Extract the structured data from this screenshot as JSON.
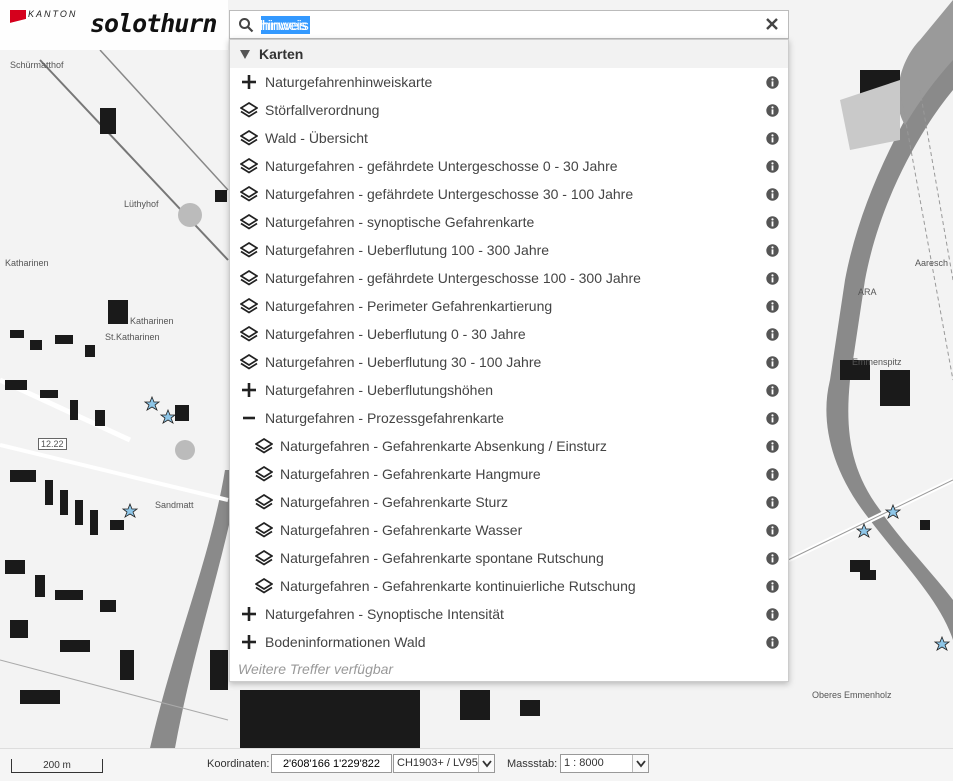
{
  "logo": {
    "kanton": "KANTON",
    "name": "solothurn",
    "flag_color": "#d5001c"
  },
  "search": {
    "query": "hinweis",
    "placeholder": ""
  },
  "results": {
    "section_title": "Karten",
    "items": [
      {
        "label": "Naturgefahrenhinweiskarte",
        "icon": "plus-icon",
        "level": 0
      },
      {
        "label": "Störfallverordnung",
        "icon": "layers-icon",
        "level": 0
      },
      {
        "label": "Wald - Übersicht",
        "icon": "layers-icon",
        "level": 0
      },
      {
        "label": "Naturgefahren - gefährdete Untergeschosse 0 - 30 Jahre",
        "icon": "layers-icon",
        "level": 0
      },
      {
        "label": "Naturgefahren - gefährdete Untergeschosse 30 - 100 Jahre",
        "icon": "layers-icon",
        "level": 0
      },
      {
        "label": "Naturgefahren - synoptische Gefahrenkarte",
        "icon": "layers-icon",
        "level": 0
      },
      {
        "label": "Naturgefahren - Ueberflutung 100 - 300 Jahre",
        "icon": "layers-icon",
        "level": 0
      },
      {
        "label": "Naturgefahren - gefährdete Untergeschosse 100 - 300 Jahre",
        "icon": "layers-icon",
        "level": 0
      },
      {
        "label": "Naturgefahren - Perimeter Gefahrenkartierung",
        "icon": "layers-icon",
        "level": 0
      },
      {
        "label": "Naturgefahren - Ueberflutung 0 - 30 Jahre",
        "icon": "layers-icon",
        "level": 0
      },
      {
        "label": "Naturgefahren - Ueberflutung 30 - 100 Jahre",
        "icon": "layers-icon",
        "level": 0
      },
      {
        "label": "Naturgefahren - Ueberflutungshöhen",
        "icon": "plus-icon",
        "level": 0
      },
      {
        "label": "Naturgefahren - Prozessgefahrenkarte",
        "icon": "minus-icon",
        "level": 0
      },
      {
        "label": "Naturgefahren - Gefahrenkarte Absenkung / Einsturz",
        "icon": "layers-icon",
        "level": 1
      },
      {
        "label": "Naturgefahren - Gefahrenkarte Hangmure",
        "icon": "layers-icon",
        "level": 1
      },
      {
        "label": "Naturgefahren - Gefahrenkarte Sturz",
        "icon": "layers-icon",
        "level": 1
      },
      {
        "label": "Naturgefahren - Gefahrenkarte Wasser",
        "icon": "layers-icon",
        "level": 1
      },
      {
        "label": "Naturgefahren - Gefahrenkarte spontane Rutschung",
        "icon": "layers-icon",
        "level": 1
      },
      {
        "label": "Naturgefahren - Gefahrenkarte kontinuierliche Rutschung",
        "icon": "layers-icon",
        "level": 1
      },
      {
        "label": "Naturgefahren - Synoptische Intensität",
        "icon": "plus-icon",
        "level": 0
      },
      {
        "label": "Bodeninformationen Wald",
        "icon": "plus-icon",
        "level": 0
      }
    ],
    "more_text": "Weitere Treffer verfügbar"
  },
  "map_labels": {
    "schuermatthof": "Schürmatthof",
    "luethyhof": "Lüthyhof",
    "katharinen": "Katharinen",
    "katharinen2": "Katharinen",
    "st_katharinen": "St.Katharinen",
    "sandmatt": "Sandmatt",
    "road": "12.22",
    "aareschachen": "Aaresch",
    "ara": "ARA",
    "emmenspitz": "Emmenspitz",
    "oberes_emmenholz": "Oberes Emmenholz"
  },
  "bottombar": {
    "scale_text": "200 m",
    "coord_label": "Koordinaten:",
    "coord_value": "2'608'166 1'229'822",
    "crs_value": "CH1903+ / LV95",
    "scale_label": "Massstab:",
    "scale_value": "1 : 8000"
  },
  "colors": {
    "highlight": "#3399ff",
    "star": "#8ec6e8"
  }
}
